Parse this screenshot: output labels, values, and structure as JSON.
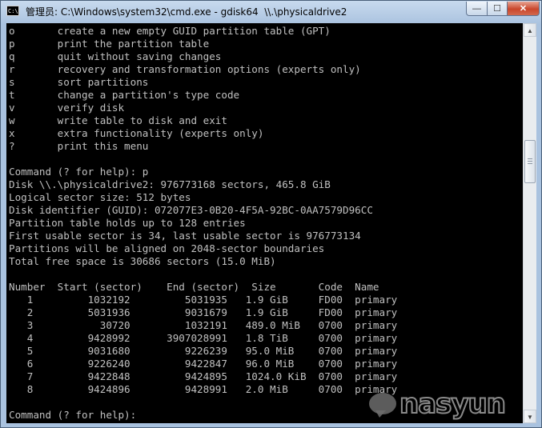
{
  "window": {
    "title": "管理员: C:\\Windows\\system32\\cmd.exe - gdisk64  \\\\.\\physicaldrive2",
    "app_icon": "C:\\",
    "buttons": {
      "minimize": "—",
      "maximize": "☐",
      "close": "✕"
    }
  },
  "console": {
    "lines": [
      "o       create a new empty GUID partition table (GPT)",
      "p       print the partition table",
      "q       quit without saving changes",
      "r       recovery and transformation options (experts only)",
      "s       sort partitions",
      "t       change a partition's type code",
      "v       verify disk",
      "w       write table to disk and exit",
      "x       extra functionality (experts only)",
      "?       print this menu",
      "",
      "Command (? for help): p",
      "Disk \\\\.\\physicaldrive2: 976773168 sectors, 465.8 GiB",
      "Logical sector size: 512 bytes",
      "Disk identifier (GUID): 072077E3-0B20-4F5A-92BC-0AA7579D96CC",
      "Partition table holds up to 128 entries",
      "First usable sector is 34, last usable sector is 976773134",
      "Partitions will be aligned on 2048-sector boundaries",
      "Total free space is 30686 sectors (15.0 MiB)",
      "",
      "Number  Start (sector)    End (sector)  Size       Code  Name",
      "   1         1032192         5031935   1.9 GiB     FD00  primary",
      "   2         5031936         9031679   1.9 GiB     FD00  primary",
      "   3           30720         1032191   489.0 MiB   0700  primary",
      "   4         9428992      3907028991   1.8 TiB     0700  primary",
      "   5         9031680         9226239   95.0 MiB    0700  primary",
      "   6         9226240         9422847   96.0 MiB    0700  primary",
      "   7         9422848         9424895   1024.0 KiB  0700  primary",
      "   8         9424896         9428991   2.0 MiB     0700  primary",
      "",
      "Command (? for help): "
    ]
  },
  "scrollbar": {
    "up_arrow": "▲",
    "down_arrow": "▼"
  },
  "watermark": {
    "text": "nasyun"
  },
  "icons": [
    "cmd-app-icon",
    "minimize-icon",
    "maximize-icon",
    "close-icon",
    "scroll-up-icon",
    "scroll-down-icon",
    "chat-bubble-icon"
  ]
}
